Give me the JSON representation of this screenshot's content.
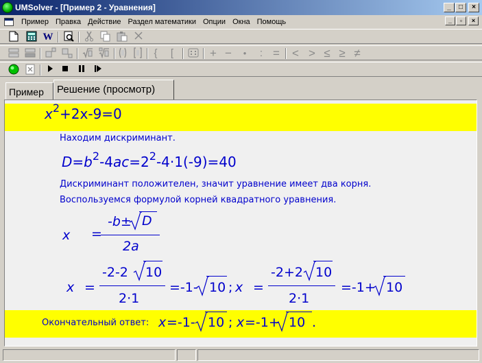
{
  "window": {
    "title": "UMSolver - [Пример 2 - Уравнения]",
    "minimize": "_",
    "maximize": "□",
    "close": "×",
    "mdi_minimize": "_",
    "mdi_restore": "▫",
    "mdi_close": "×"
  },
  "menu": {
    "items": [
      "Пример",
      "Правка",
      "Действие",
      "Раздел математики",
      "Опции",
      "Окна",
      "Помощь"
    ]
  },
  "toolbar1": {
    "icons": [
      "new-icon",
      "calculator-icon",
      "word-icon",
      "preview-icon",
      "cut-icon",
      "copy-icon",
      "paste-icon",
      "delete-icon"
    ],
    "word_label": "W"
  },
  "toolbar2": {
    "symbols": [
      "{",
      "[",
      "+",
      "−",
      "•",
      ":",
      "=",
      "<",
      ">",
      "≤",
      "≥",
      "≠"
    ]
  },
  "toolbar3": {
    "icons": [
      "run-icon",
      "clear-icon",
      "play-icon",
      "stop-icon",
      "pause-icon",
      "step-icon"
    ]
  },
  "tabs": [
    {
      "label": "Пример",
      "active": false
    },
    {
      "label": "Решение (просмотр)",
      "active": true
    }
  ],
  "solution": {
    "equation": {
      "x": "x",
      "exp": "2",
      "rest": "+2x-9=0"
    },
    "step1": "Находим дискриминант.",
    "discriminant": {
      "d": "D",
      "eq": "=",
      "b": "b",
      "exp": "2",
      "mid": "-4",
      "ac": "ac",
      "eq2": "=2",
      "exp2": "2",
      "tail": "-4·1(-9)=40"
    },
    "step2": "Дискриминант положителен, значит уравнение имеет два корня.",
    "step3": "Воспользуемся формулой корней квадратного уравнения.",
    "formula": {
      "x": "x",
      "eq": "=",
      "num_left": "-b±",
      "num_radicand": "D",
      "den": "2a"
    },
    "roots": {
      "x1": "x",
      "eq1": "=",
      "num1_left": "-2-2",
      "num1_rad": "10",
      "den1": "2·1",
      "res1_left": "=-1-",
      "res1_rad": "10",
      "sep": ";",
      "x2": "x",
      "eq2": "=",
      "num2_left": "-2+2",
      "num2_rad": "10",
      "den2": "2·1",
      "res2_left": "=-1+",
      "res2_rad": "10"
    },
    "answer": {
      "label": "Окончательный ответ:",
      "x1": "x",
      "val1_left": "=-1-",
      "val1_rad": "10",
      "sep": ";",
      "x2": "x",
      "val2_left": "=-1+",
      "val2_rad": "10",
      "end": "."
    }
  },
  "colors": {
    "highlight": "#ffff00",
    "math": "#0000cc",
    "title_start": "#0a246a",
    "title_end": "#a6caf0"
  }
}
